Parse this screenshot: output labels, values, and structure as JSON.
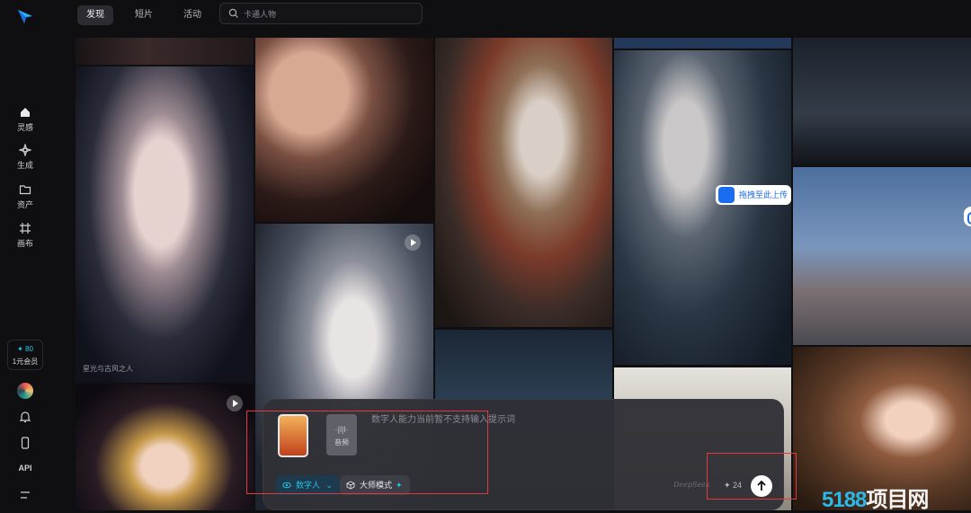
{
  "topbar": {
    "tabs": [
      {
        "label": "发现",
        "active": true
      },
      {
        "label": "短片",
        "active": false
      },
      {
        "label": "活动",
        "active": false
      }
    ],
    "search": {
      "placeholder": "卡通人物",
      "value": ""
    }
  },
  "sidebar": {
    "items": [
      {
        "label": "灵感",
        "icon": "home-icon",
        "active": true
      },
      {
        "label": "生成",
        "icon": "sparkle-icon",
        "active": false
      },
      {
        "label": "资产",
        "icon": "folder-icon",
        "active": false
      },
      {
        "label": "画布",
        "icon": "canvas-icon",
        "active": false
      }
    ],
    "credits": {
      "amount": "✦ 80",
      "membership": "1元会员"
    },
    "bottom_icons": [
      "avatar",
      "bell-icon",
      "phone-icon",
      "api-label",
      "menu-icon"
    ],
    "api_label": "API"
  },
  "gallery": {
    "upload_button": "拖拽至此上传",
    "tile_caption": "星光与古风之人"
  },
  "composer": {
    "placeholder": "数字人能力当前暂不支持输入提示词",
    "audio_label": "音频",
    "audio_wave": "·|l|l·",
    "mode_digital_human": "数字人",
    "mode_master": "大师模式",
    "count": "✦ 24",
    "watermark": "DeepSeek"
  },
  "watermark_brand": {
    "text_a": "5188",
    "text_b": "项目网"
  },
  "colors": {
    "accent": "#22c3e6",
    "upload_blue": "#1a6cf0",
    "annotation_red": "#e03a3a",
    "background": "#0f0f12"
  }
}
